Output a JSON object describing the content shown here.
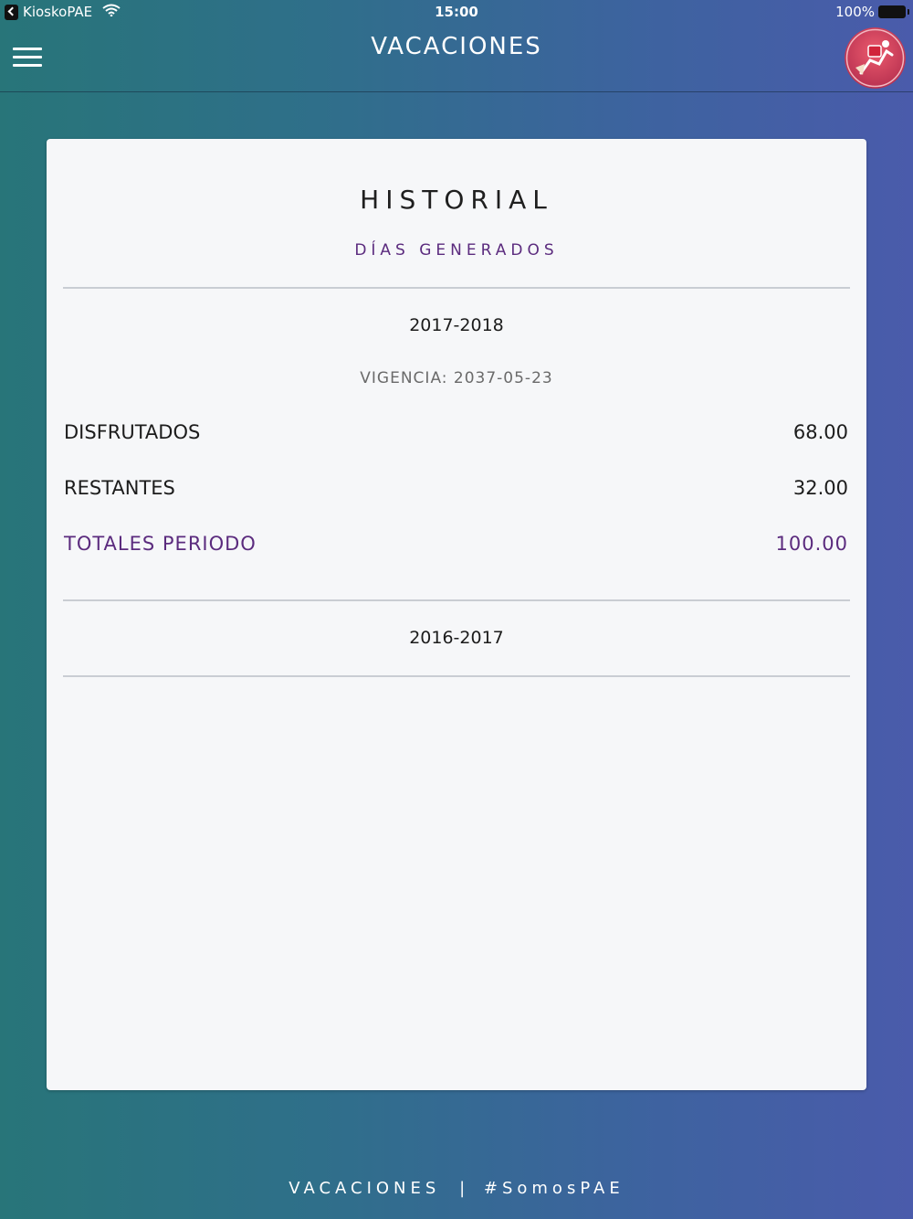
{
  "status_bar": {
    "app_name": "KioskoPAE",
    "time": "15:00",
    "battery": "100%"
  },
  "nav": {
    "title": "VACACIONES"
  },
  "card": {
    "title": "HISTORIAL",
    "subtitle": "DÍAS GENERADOS",
    "periods": [
      {
        "label": "2017-2018",
        "vigencia": "VIGENCIA: 2037-05-23",
        "rows": [
          {
            "label": "DISFRUTADOS",
            "value": "68.00"
          },
          {
            "label": "RESTANTES",
            "value": "32.00"
          },
          {
            "label": "TOTALES PERIODO",
            "value": "100.00"
          }
        ]
      },
      {
        "label": "2016-2017"
      }
    ]
  },
  "footer": {
    "left": "VACACIONES",
    "separator": "|",
    "right": "#SomosPAE"
  },
  "colors": {
    "accent_purple": "#5b2b7e",
    "gradient_left": "#287579",
    "gradient_right": "#4a5bab",
    "card_background": "#f6f7f9"
  }
}
